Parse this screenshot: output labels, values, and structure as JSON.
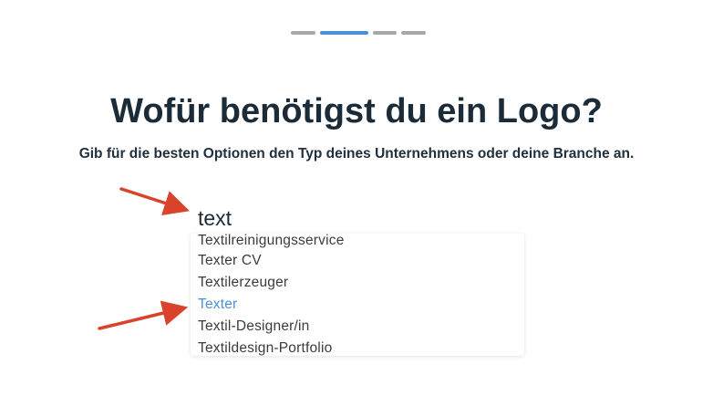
{
  "progress": {
    "total_steps": 4,
    "current_step": 2
  },
  "heading": {
    "title": "Wofür benötigst du ein Logo?",
    "subtitle": "Gib für die besten Optionen den Typ deines Unternehmens oder deine Branche an."
  },
  "search": {
    "value": "text"
  },
  "suggestions": [
    {
      "label": "Textilreinigungsservice",
      "highlighted": false
    },
    {
      "label": "Texter CV",
      "highlighted": false
    },
    {
      "label": "Textilerzeuger",
      "highlighted": false
    },
    {
      "label": "Texter",
      "highlighted": true
    },
    {
      "label": "Textil-Designer/in",
      "highlighted": false
    },
    {
      "label": "Textildesign-Portfolio",
      "highlighted": false
    }
  ],
  "colors": {
    "progress_active": "#4a90d9",
    "progress_inactive": "#a8a8a8",
    "highlight": "#4a90d9",
    "annotation_arrow": "#d9432b"
  },
  "annotations": [
    {
      "name": "red-arrow-icon",
      "points_to": "search-input"
    },
    {
      "name": "red-arrow-icon",
      "points_to": "suggestion-texter"
    }
  ]
}
